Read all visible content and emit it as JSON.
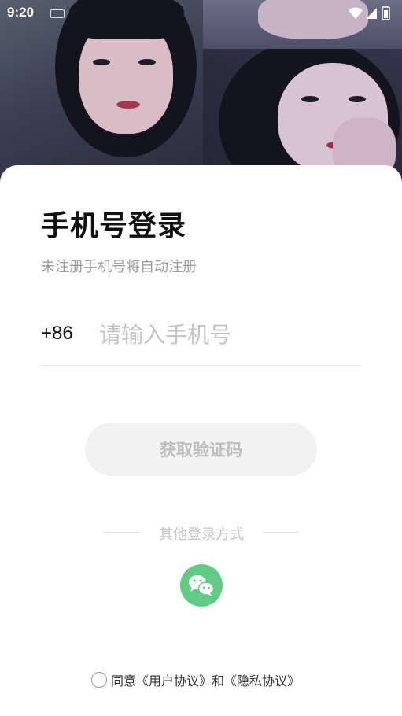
{
  "status_bar": {
    "time": "9:20",
    "icons": [
      "keyboard-icon",
      "wifi-icon",
      "signal-icon",
      "battery-icon"
    ]
  },
  "login": {
    "title": "手机号登录",
    "subtitle": "未注册手机号将自动注册",
    "country_code": "+86",
    "phone_placeholder": "请输入手机号",
    "phone_value": "",
    "get_code_label": "获取验证码",
    "other_methods_label": "其他登录方式",
    "wechat_icon": "wechat-icon"
  },
  "agreement": {
    "checked": false,
    "prefix": "同意",
    "user_agreement": "《用户协议》",
    "conjunction": "和",
    "privacy_agreement": "《隐私协议》"
  },
  "colors": {
    "wechat_green": "#5fcb83",
    "button_disabled_bg": "#f2f2f2",
    "button_disabled_text": "#bdbdbd",
    "placeholder": "#c4c4c4"
  }
}
